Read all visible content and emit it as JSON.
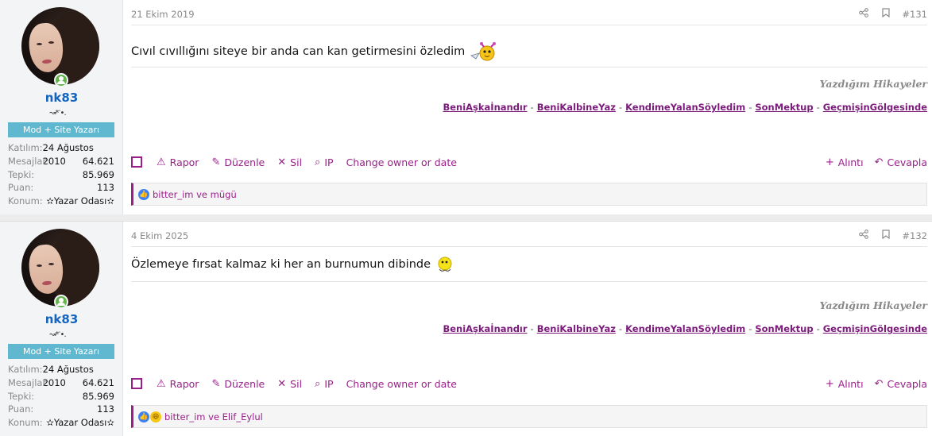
{
  "posts": [
    {
      "user": {
        "name": "nk83",
        "flair": "↝*ॱ•.",
        "role": "Mod + Site Yazarı",
        "stats": [
          {
            "key": "Katılım:",
            "value": "24 Ağustos 2010"
          },
          {
            "key": "Mesajlar:",
            "value": "64.621"
          },
          {
            "key": "Tepki:",
            "value": "85.969"
          },
          {
            "key": "Puan:",
            "value": "113"
          },
          {
            "key": "Konum:",
            "value": "✫Yazar Odası✫"
          }
        ]
      },
      "date": "21 Ekim 2019",
      "number": "#131",
      "message": "Cıvıl cıvıllığını siteye bir anda can kan getirmesini özledim",
      "signature": {
        "title": "Yazdığım Hikayeler",
        "links": [
          "BeniAşkaİnandır",
          "BeniKalbineYaz",
          "KendimeYalanSöyledim",
          "SonMektup",
          "GeçmişinGölgesinde"
        ]
      },
      "actions": {
        "report": "Rapor",
        "edit": "Düzenle",
        "delete": "Sil",
        "ip": "IP",
        "change": "Change owner or date",
        "quote": "Alıntı",
        "reply": "Cevapla"
      },
      "reactions": "bitter_im ve mügü",
      "reaction_icons": [
        "like"
      ]
    },
    {
      "user": {
        "name": "nk83",
        "flair": "↝*ॱ•.",
        "role": "Mod + Site Yazarı",
        "stats": [
          {
            "key": "Katılım:",
            "value": "24 Ağustos 2010"
          },
          {
            "key": "Mesajlar:",
            "value": "64.621"
          },
          {
            "key": "Tepki:",
            "value": "85.969"
          },
          {
            "key": "Puan:",
            "value": "113"
          },
          {
            "key": "Konum:",
            "value": "✫Yazar Odası✫"
          }
        ]
      },
      "date": "4 Ekim 2025",
      "number": "#132",
      "message": "Özlemeye fırsat kalmaz ki her an burnumun dibinde",
      "signature": {
        "title": "Yazdığım Hikayeler",
        "links": [
          "BeniAşkaİnandır",
          "BeniKalbineYaz",
          "KendimeYalanSöyledim",
          "SonMektup",
          "GeçmişinGölgesinde"
        ]
      },
      "actions": {
        "report": "Rapor",
        "edit": "Düzenle",
        "delete": "Sil",
        "ip": "IP",
        "change": "Change owner or date",
        "quote": "Alıntı",
        "reply": "Cevapla"
      },
      "reactions": "bitter_im ve Elif_Eylul",
      "reaction_icons": [
        "like",
        "haha"
      ]
    }
  ],
  "colors": {
    "accent": "#9a1f8a",
    "username": "#1565c0",
    "badge": "#5fb8cf",
    "online": "#63b44d"
  }
}
